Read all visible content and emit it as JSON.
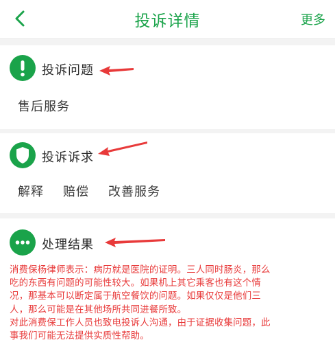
{
  "header": {
    "title": "投诉详情",
    "more_label": "更多"
  },
  "sections": {
    "issue": {
      "title": "投诉问题",
      "value": "售后服务"
    },
    "demand": {
      "title": "投诉诉求",
      "tags": [
        "解释",
        "赔偿",
        "改善服务"
      ]
    },
    "result": {
      "title": "处理结果",
      "text": "消费保杨律师表示：病历就是医院的证明。三人同时肠炎，那么\n吃的东西有问题的可能性较大。如果机上其它乘客也有这个情\n况，那基本可以断定属于航空餐饮的问题。如果仅仅是他们三\n人，那么可能是在其他场所共同进餐所致。\n对此消费保工作人员也致电投诉人沟通，由于证据收集问题，此\n事我们可能无法提供实质性帮助。"
    }
  },
  "colors": {
    "accent": "#1aa34a",
    "annotation": "#e83a3a"
  },
  "icons": {
    "back": "chevron-left-icon",
    "issue": "exclamation-icon",
    "demand": "shield-icon",
    "result": "ellipsis-icon"
  }
}
